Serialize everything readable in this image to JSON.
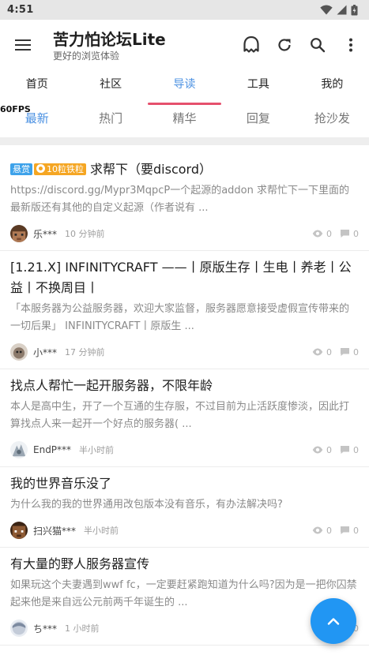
{
  "status_bar": {
    "time": "4:51"
  },
  "app_bar": {
    "title": "苦力怕论坛Lite",
    "subtitle": "更好的浏览体验"
  },
  "main_tabs": [
    {
      "label": "首页"
    },
    {
      "label": "社区"
    },
    {
      "label": "导读",
      "active": true
    },
    {
      "label": "工具"
    },
    {
      "label": "我的"
    }
  ],
  "sub_tabs": [
    {
      "label": "最新",
      "active": true
    },
    {
      "label": "热门"
    },
    {
      "label": "精华"
    },
    {
      "label": "回复"
    },
    {
      "label": "抢沙发"
    }
  ],
  "fps_label": "60FPS",
  "posts": [
    {
      "badge_reward": "悬赏",
      "badge_coins": "10粒铁粒",
      "title": "求帮下（要discord）",
      "excerpt": "https://discord.gg/Mypr3MqpcP一个起源的addon 求帮忙下一下里面的最新版还有其他的自定义起源（作者说有 ...",
      "author": "乐***",
      "time": "10 分钟前",
      "views": "0",
      "replies": "0"
    },
    {
      "title": "[1.21.X] INFINITYCRAFT ——丨原版生存丨生电丨养老丨公益丨不换周目丨",
      "excerpt": "「本服务器为公益服务器，欢迎大家监督，服务器愿意接受虚假宣传带来的一切后果」 INFINITYCRAFT丨原版生 ...",
      "author": "小***",
      "time": "17 分钟前",
      "views": "0",
      "replies": "0"
    },
    {
      "title": "找点人帮忙一起开服务器，不限年龄",
      "excerpt": "本人是高中生，开了一个互通的生存服，不过目前为止活跃度惨淡，因此打算找点人来一起开一个好点的服务器( ...",
      "author": "EndP***",
      "time": "半小时前",
      "views": "0",
      "replies": "0"
    },
    {
      "title": "我的世界音乐没了",
      "excerpt": "为什么我的我的世界通用改包版本没有音乐，有办法解决吗?",
      "author": "扫兴猫***",
      "time": "半小时前",
      "views": "0",
      "replies": "0"
    },
    {
      "title": "有大量的野人服务器宣传",
      "excerpt": "如果玩这个夫妻遇到wwf fc，一定要赶紧跑知道为什么吗?因为是一把你囚禁起来他是来自远公元前两千年诞生的 ...",
      "author": "ち***",
      "time": "1 小时前",
      "views": "0",
      "replies": "0"
    }
  ],
  "colors": {
    "accent": "#4a90e2",
    "indicator": "#e6506d",
    "fab": "#2196f3"
  },
  "icons": {
    "menu": "hamburger-icon",
    "creeper": "creeper-icon",
    "refresh": "refresh-icon",
    "search": "search-icon",
    "more": "more-vert-icon",
    "fab": "chevron-up-icon"
  }
}
